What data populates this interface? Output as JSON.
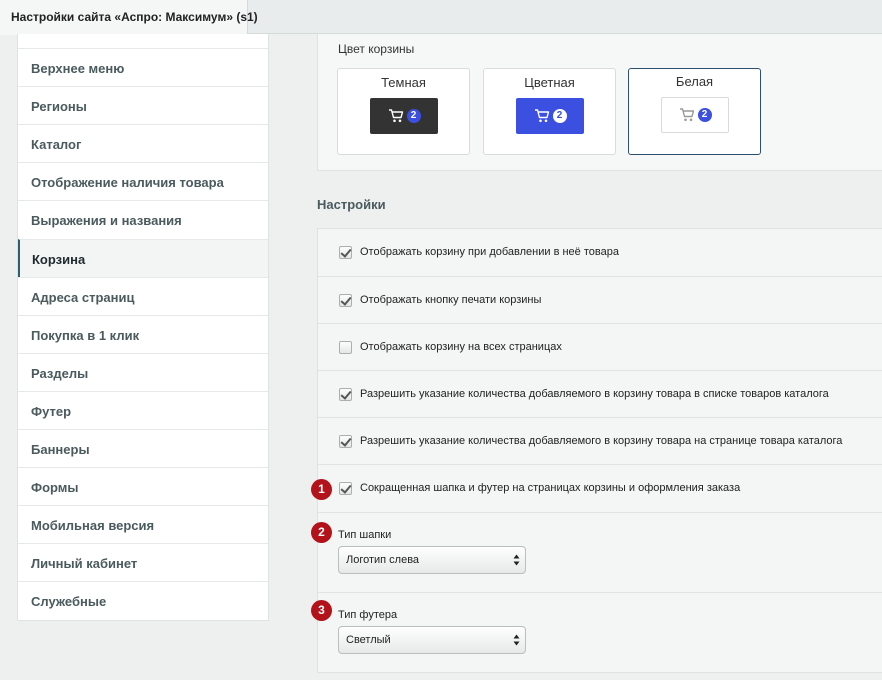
{
  "tab": {
    "title": "Настройки сайта «Аспро: Максимум» (s1)"
  },
  "sidebar": {
    "items": [
      {
        "label": "Верхнее меню"
      },
      {
        "label": "Регионы"
      },
      {
        "label": "Каталог"
      },
      {
        "label": "Отображение наличия товара"
      },
      {
        "label": "Выражения и названия"
      },
      {
        "label": "Корзина",
        "active": true
      },
      {
        "label": "Адреса страниц"
      },
      {
        "label": "Покупка в 1 клик"
      },
      {
        "label": "Разделы"
      },
      {
        "label": "Футер"
      },
      {
        "label": "Баннеры"
      },
      {
        "label": "Формы"
      },
      {
        "label": "Мобильная версия"
      },
      {
        "label": "Личный кабинет"
      },
      {
        "label": "Служебные"
      }
    ]
  },
  "cart_color": {
    "label": "Цвет корзины",
    "options": [
      {
        "title": "Темная",
        "count": "2"
      },
      {
        "title": "Цветная",
        "count": "2"
      },
      {
        "title": "Белая",
        "count": "2",
        "selected": true
      }
    ]
  },
  "settings": {
    "title": "Настройки",
    "checkboxes": [
      {
        "label": "Отображать корзину при добавлении в неё товара",
        "checked": true
      },
      {
        "label": "Отображать кнопку печати корзины",
        "checked": true
      },
      {
        "label": "Отображать корзину на всех страницах",
        "checked": false
      },
      {
        "label": "Разрешить указание количества добавляемого в корзину товара в списке товаров каталога",
        "checked": true
      },
      {
        "label": "Разрешить указание количества добавляемого в корзину товара на странице товара каталога",
        "checked": true
      },
      {
        "label": "Сокращенная шапка и футер на страницах корзины и оформления заказа",
        "checked": true,
        "marker": "1"
      }
    ],
    "header_type": {
      "label": "Тип шапки",
      "value": "Логотип слева",
      "marker": "2"
    },
    "footer_type": {
      "label": "Тип футера",
      "value": "Светлый",
      "marker": "3"
    }
  },
  "colors": {
    "accent_blue": "#3b4fe0",
    "dark_button": "#333333",
    "marker_red": "#b3121b"
  }
}
